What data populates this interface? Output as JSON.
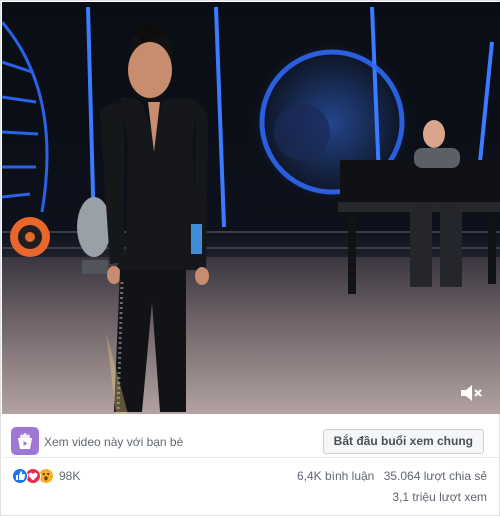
{
  "watch_party": {
    "prompt": "Xem video này với bạn bè",
    "button_label": "Bắt đầu buổi xem chung"
  },
  "stats": {
    "reaction_count": "98K",
    "comments": "6,4K bình luận",
    "shares": "35.064 lượt chia sẻ",
    "views": "3,1 triệu lượt xem"
  },
  "icons": {
    "volume": "volume-muted-icon",
    "watch_party": "watch-party-icon",
    "reactions": [
      "like-icon",
      "love-icon",
      "wow-icon"
    ]
  },
  "colors": {
    "accent_blue": "#1877f2",
    "watch_party_purple": "#9f78d6",
    "stage_neon": "#2f6bff"
  }
}
